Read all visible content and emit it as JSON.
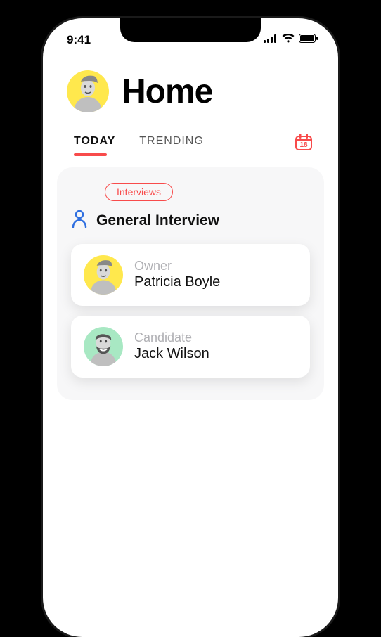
{
  "status_bar": {
    "time": "9:41"
  },
  "header": {
    "title": "Home"
  },
  "tabs": {
    "items": [
      {
        "label": "TODAY",
        "active": true
      },
      {
        "label": "TRENDING",
        "active": false
      }
    ],
    "calendar_day": "18"
  },
  "card": {
    "pill_label": "Interviews",
    "title": "General Interview",
    "people": [
      {
        "role": "Owner",
        "name": "Patricia Boyle",
        "avatar_bg": "yellow"
      },
      {
        "role": "Candidate",
        "name": "Jack Wilson",
        "avatar_bg": "green"
      }
    ]
  },
  "colors": {
    "accent_red": "#f84b4b",
    "accent_blue": "#2f6fe0",
    "avatar_yellow": "#ffe84d",
    "avatar_green": "#a8e8c3"
  }
}
